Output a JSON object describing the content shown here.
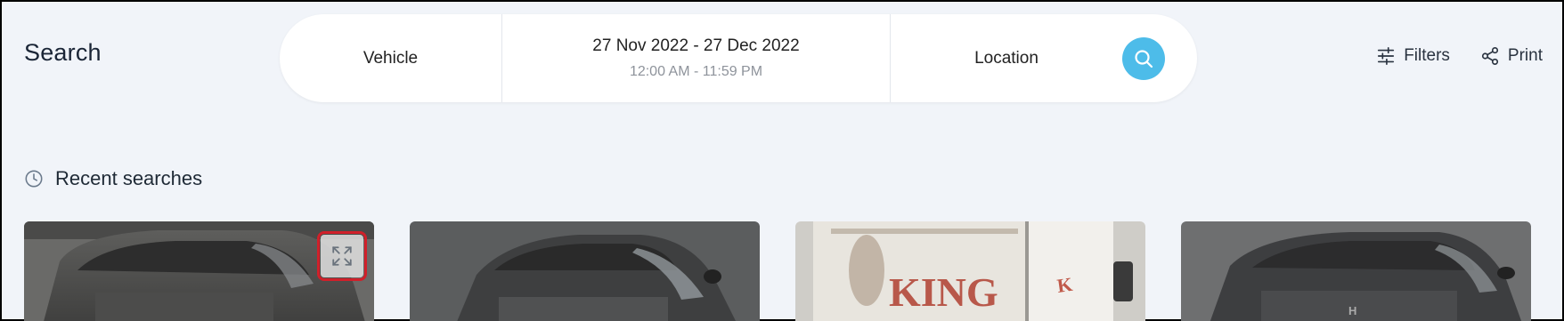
{
  "page": {
    "title": "Search"
  },
  "searchbar": {
    "vehicle_label": "Vehicle",
    "date_range": "27 Nov 2022 - 27 Dec 2022",
    "time_range": "12:00 AM - 11:59 PM",
    "location_label": "Location",
    "search_icon": "search-icon",
    "accent_color": "#4dbce9"
  },
  "actions": {
    "filters_label": "Filters",
    "filters_icon": "sliders-icon",
    "print_label": "Print",
    "print_icon": "share-icon"
  },
  "recent": {
    "title": "Recent searches",
    "icon": "clock-icon",
    "cards": [
      {
        "subject": "dark sedan rear view",
        "expand_icon": "expand-icon"
      },
      {
        "subject": "dark sedan rear view"
      },
      {
        "subject": "white van rear view",
        "van_text": "KING"
      },
      {
        "subject": "dark sedan rear view"
      }
    ]
  }
}
